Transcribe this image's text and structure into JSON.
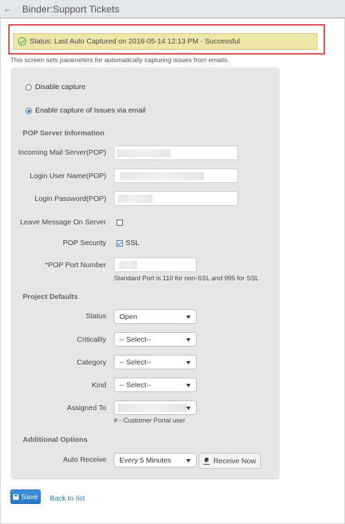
{
  "header": {
    "back_icon": "arrow-left-icon",
    "back_glyph": "←",
    "title": "Binder:Support Tickets"
  },
  "status": {
    "icon": "check-circle-icon",
    "text": "Status: Last Auto Captured on 2016-05-14 12:13 PM - Successful",
    "highlight_color": "#e04545",
    "background_color": "#efe7a8"
  },
  "description": "This screen sets parameters for automatically capturing issues from emails.",
  "capture_options": [
    {
      "label": "Disable capture",
      "checked": false
    },
    {
      "label": "Enable capture of Issues via email",
      "checked": true
    }
  ],
  "pop_server": {
    "section_title": "POP Server Information",
    "incoming_mail_server": {
      "label": "Incoming Mail Server(POP)",
      "value": ""
    },
    "login_user_name": {
      "label": "Login User Name(POP)",
      "value": ""
    },
    "login_password": {
      "label": "Login Password(POP)",
      "value": ""
    },
    "leave_message": {
      "label": "Leave Message On Server",
      "checked": false
    },
    "pop_security": {
      "label": "POP Security",
      "option_label": "SSL",
      "checked": true
    },
    "port_number": {
      "label": "*POP Port Number",
      "value": "",
      "hint": "Standard Port is 110 for non-SSL and 995 for SSL"
    }
  },
  "project_defaults": {
    "section_title": "Project Defaults",
    "status": {
      "label": "Status",
      "selected": "Open"
    },
    "criticality": {
      "label": "Criticality",
      "selected": "-- Select--"
    },
    "category": {
      "label": "Category",
      "selected": "-- Select--"
    },
    "kind": {
      "label": "Kind",
      "selected": "-- Select--"
    },
    "assigned_to": {
      "label": "Assigned To",
      "selected": "",
      "hint": "# - Customer Portal user"
    }
  },
  "additional_options": {
    "section_title": "Additional Options",
    "auto_receive": {
      "label": "Auto Receive",
      "selected": "Every 5 Minutes"
    },
    "receive_now_label": "Receive Now",
    "receive_now_icon": "download-icon"
  },
  "footer": {
    "save_label": "Save",
    "save_icon": "floppy-disk-icon",
    "back_link": "Back to list",
    "accent_color": "#2a78c9"
  }
}
